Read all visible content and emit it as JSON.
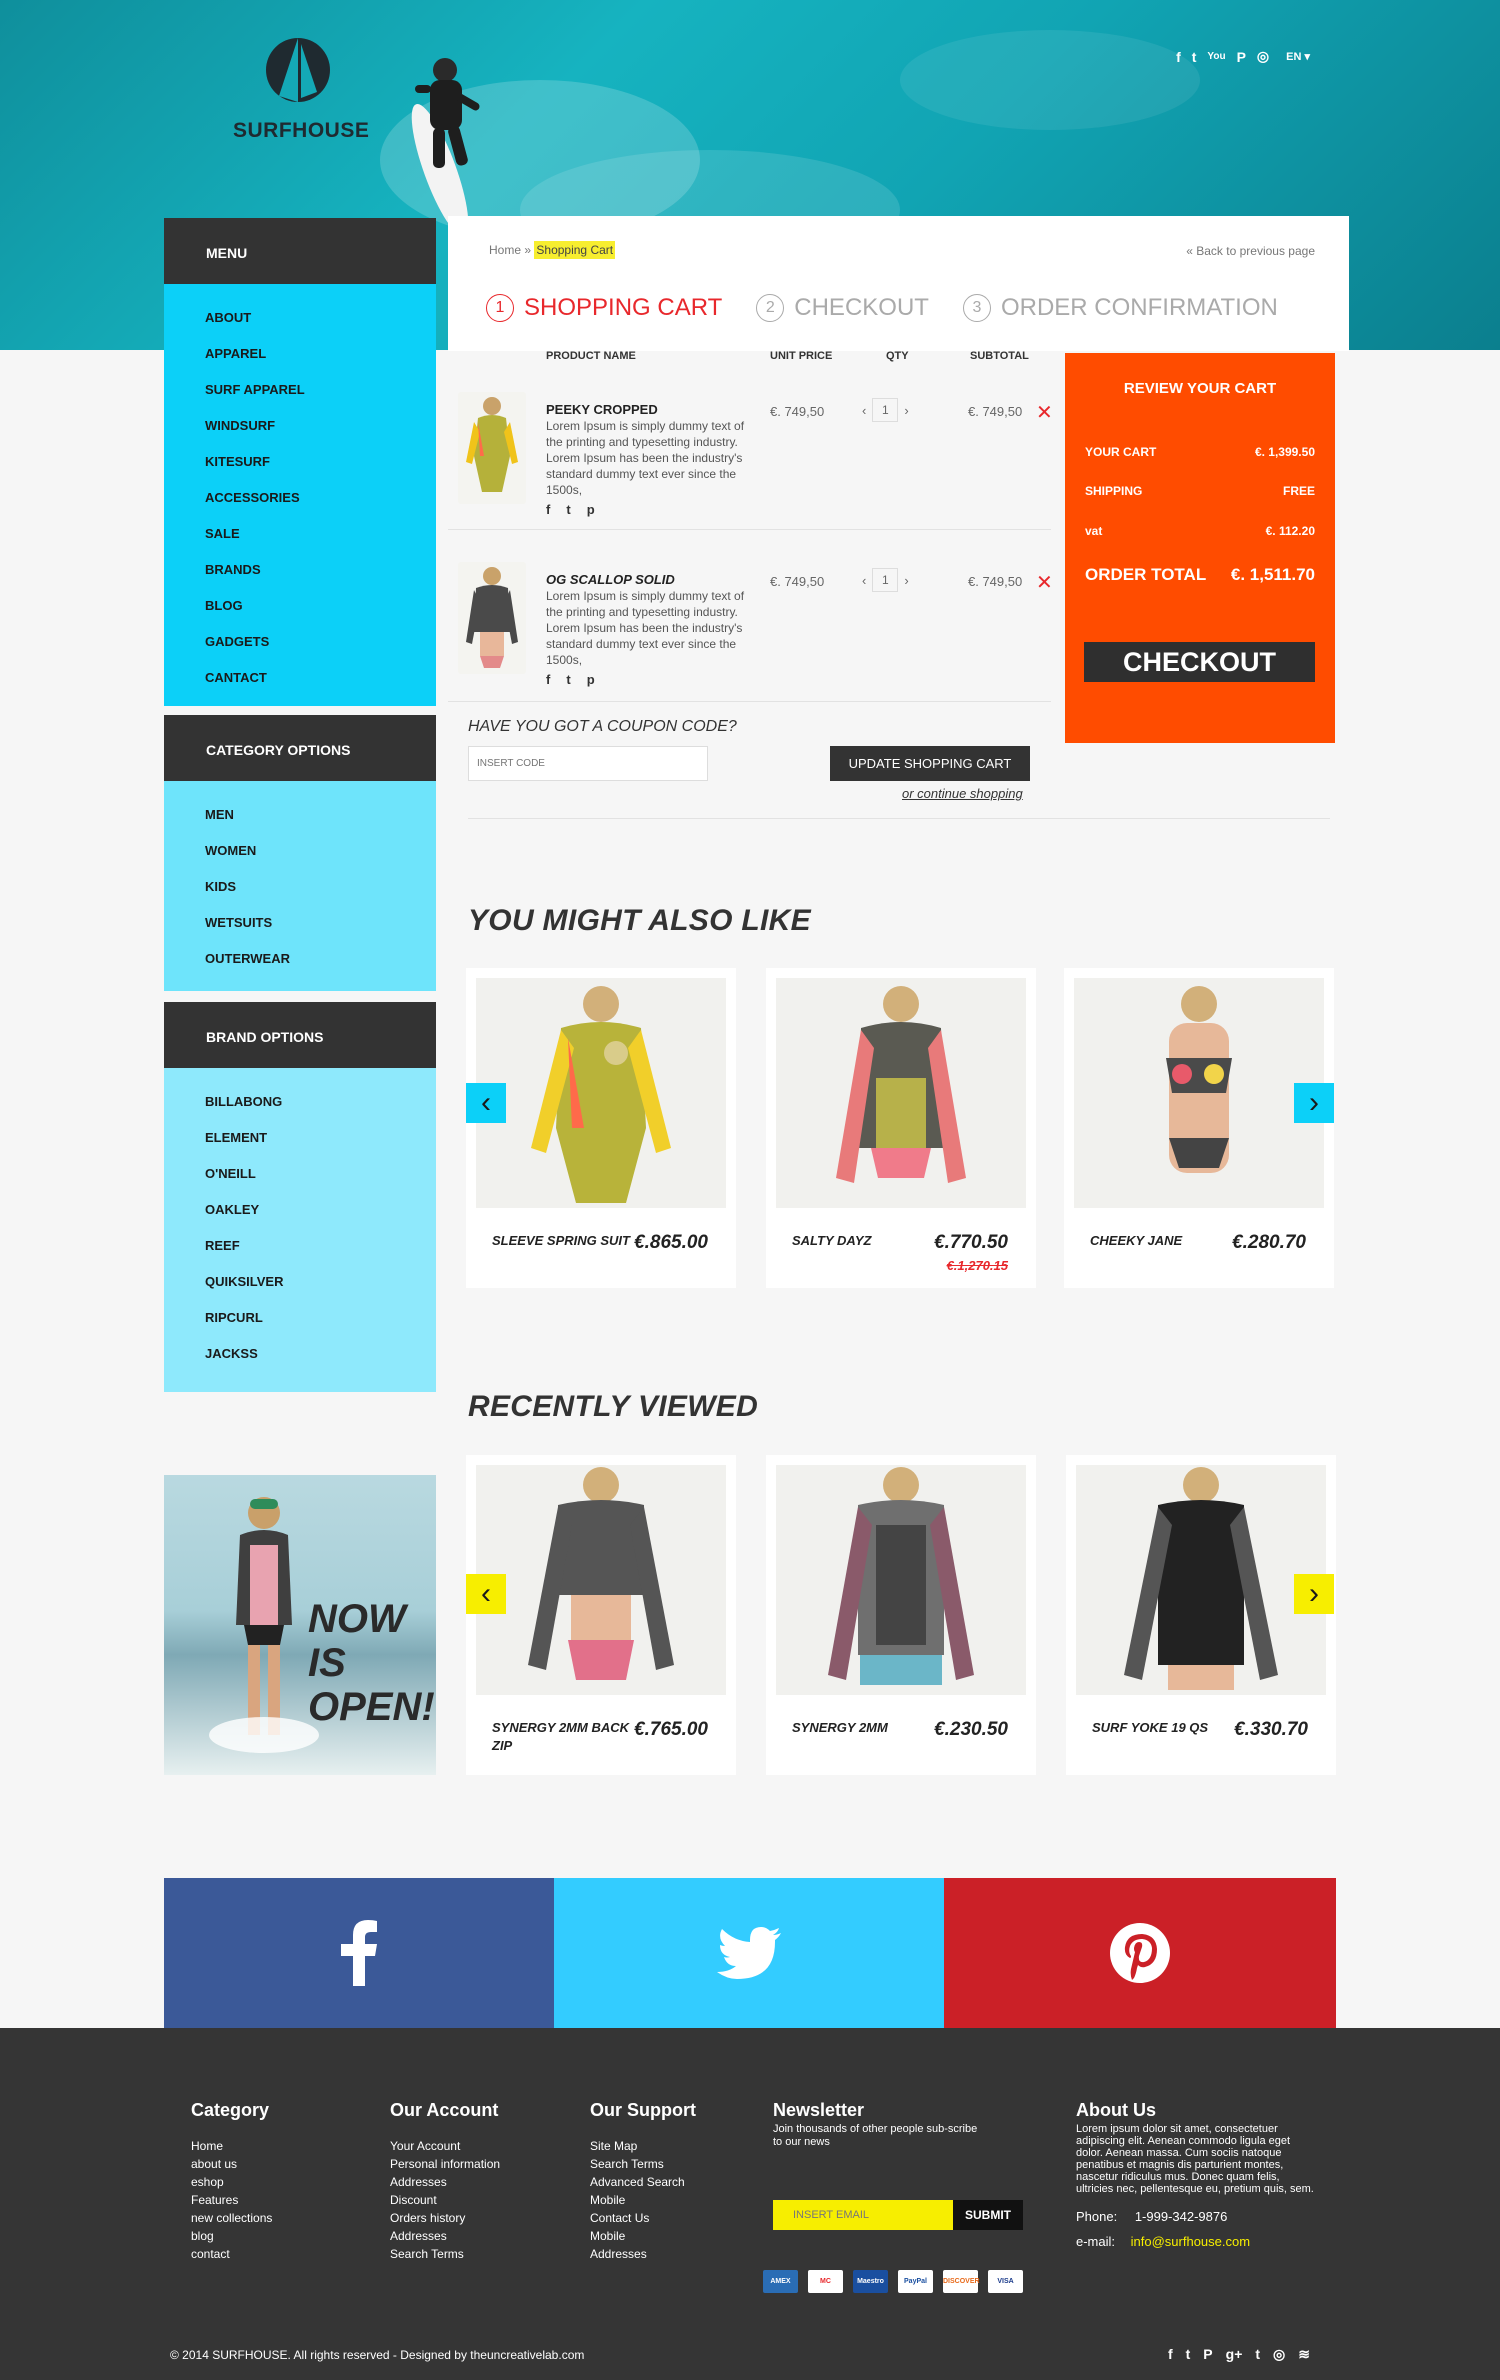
{
  "brand": {
    "name": "SURFHOUSE"
  },
  "header": {
    "social": [
      "f",
      "t",
      "You",
      "P",
      "◎"
    ],
    "lang": "EN ▾"
  },
  "sidebar": {
    "menu_title": "MENU",
    "menu": [
      "ABOUT",
      "APPAREL",
      "SURF APPAREL",
      "WINDSURF",
      "KITESURF",
      "ACCESSORIES",
      "SALE",
      "BRANDS",
      "BLOG",
      "GADGETS",
      "CANTACT"
    ],
    "category_title": "CATEGORY OPTIONS",
    "categories": [
      "MEN",
      "WOMEN",
      "KIDS",
      "WETSUITS",
      "OUTERWEAR"
    ],
    "brand_title": "BRAND OPTIONS",
    "brands": [
      "BILLABONG",
      "ELEMENT",
      "O'NEILL",
      "OAKLEY",
      "REEF",
      "QUIKSILVER",
      "RIPCURL",
      "JACKSS"
    ]
  },
  "breadcrumb": {
    "home": "Home",
    "sep": "»",
    "current": "Shopping Cart",
    "back": "« Back to previous page"
  },
  "steps": [
    {
      "num": "1",
      "label": "SHOPPING CART"
    },
    {
      "num": "2",
      "label": "CHECKOUT"
    },
    {
      "num": "3",
      "label": "ORDER CONFIRMATION"
    }
  ],
  "cart": {
    "headers": {
      "product": "PRODUCT NAME",
      "unit": "UNIT PRICE",
      "qty": "QTY",
      "subtotal": "SUBTOTAL"
    },
    "items": [
      {
        "name": "PEEKY CROPPED",
        "desc": "Lorem Ipsum is simply dummy text of the printing and typesetting industry. Lorem Ipsum has been the industry's standard dummy text ever since the 1500s,",
        "price": "€. 749,50",
        "qty": "1",
        "subtotal": "€. 749,50",
        "soc": [
          "f",
          "t",
          "p"
        ],
        "dec": "‹",
        "inc": "›",
        "remove": "✕"
      },
      {
        "name": "OG SCALLOP SOLID",
        "desc": "Lorem Ipsum is simply dummy text of the printing and typesetting industry. Lorem Ipsum has been the industry's standard dummy text ever since the 1500s,",
        "price": "€. 749,50",
        "qty": "1",
        "subtotal": "€. 749,50",
        "soc": [
          "f",
          "t",
          "p"
        ],
        "dec": "‹",
        "inc": "›",
        "remove": "✕"
      }
    ],
    "coupon_question": "HAVE YOU GOT A COUPON CODE?",
    "coupon_placeholder": "INSERT CODE",
    "update_btn": "UPDATE SHOPPING CART",
    "continue": "or continue shopping"
  },
  "review": {
    "title": "REVIEW YOUR CART",
    "your_cart_label": "YOUR CART",
    "your_cart_value": "€. 1,399.50",
    "shipping_label": "SHIPPING",
    "shipping_value": "FREE",
    "vat_label": "vat",
    "vat_value": "€. 112.20",
    "total_label": "ORDER TOTAL",
    "total_value": "€. 1,511.70",
    "checkout_btn": "CHECKOUT"
  },
  "also_like": {
    "title": "YOU MIGHT ALSO LIKE",
    "prev": "‹",
    "next": "›",
    "items": [
      {
        "name": "SLEEVE SPRING SUIT",
        "price": "€.865.00",
        "old": ""
      },
      {
        "name": "SALTY DAYZ",
        "price": "€.770.50",
        "old": "€.1,270.15"
      },
      {
        "name": "CHEEKY JANE",
        "price": "€.280.70",
        "old": ""
      }
    ]
  },
  "recent": {
    "title": "RECENTLY VIEWED",
    "prev": "‹",
    "next": "›",
    "items": [
      {
        "name": "SYNERGY 2MM BACK ZIP",
        "price": "€.765.00"
      },
      {
        "name": "SYNERGY 2MM",
        "price": "€.230.50"
      },
      {
        "name": "SURF YOKE 19 QS",
        "price": "€.330.70"
      }
    ]
  },
  "promo": {
    "l1": "NOW",
    "l2": "IS",
    "l3": "OPEN!"
  },
  "colors": {
    "cyan": "#0cd0f8",
    "orange": "#ff4c00",
    "red": "#e8282c",
    "facebook": "#3b5998",
    "twitter": "#33ccff",
    "pinterest": "#cb2027"
  },
  "footer": {
    "category": {
      "title": "Category",
      "links": [
        "Home",
        "about us",
        "eshop",
        "Features",
        "new collections",
        "blog",
        "contact"
      ]
    },
    "account": {
      "title": "Our Account",
      "links": [
        "Your Account",
        "Personal information",
        "Addresses",
        "Discount",
        "Orders history",
        "Addresses",
        "Search Terms"
      ]
    },
    "support": {
      "title": "Our Support",
      "links": [
        "Site Map",
        "Search Terms",
        "Advanced Search",
        "Mobile",
        "Contact Us",
        "Mobile",
        "Addresses"
      ]
    },
    "newsletter": {
      "title": "Newsletter",
      "text": "Join thousands of other people sub-scribe to our news",
      "placeholder": "INSERT EMAIL",
      "btn": "SUBMIT"
    },
    "payments": [
      "AMEX",
      "MC",
      "Maestro",
      "PayPal",
      "DISCOVER",
      "VISA"
    ],
    "about": {
      "title": "About Us",
      "text": "Lorem ipsum dolor sit amet, consectetuer adipiscing elit. Aenean commodo ligula eget dolor. Aenean massa. Cum sociis natoque penatibus et magnis dis parturient montes, nascetur ridiculus mus. Donec quam felis, ultricies nec, pellentesque eu, pretium quis, sem.",
      "phone_label": "Phone:",
      "phone": "1-999-342-9876",
      "email_label": "e-mail:",
      "email": "info@surfhouse.com"
    },
    "copyright": "© 2014  SURFHOUSE. All rights reserved - Designed by theuncreativelab.com",
    "social": [
      "f",
      "t",
      "P",
      "g+",
      "t",
      "◎",
      "≋"
    ]
  }
}
